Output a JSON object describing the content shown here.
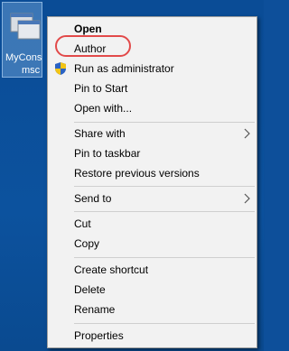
{
  "desktop_icon": {
    "label_line1": "MyCons",
    "label_line2": "msc"
  },
  "context_menu": {
    "items": [
      {
        "label": "Open"
      },
      {
        "label": "Author"
      },
      {
        "label": "Run as administrator",
        "icon": "uac-shield-icon"
      },
      {
        "label": "Pin to Start"
      },
      {
        "label": "Open with..."
      },
      {
        "label": "Share with",
        "submenu": true
      },
      {
        "label": "Pin to taskbar"
      },
      {
        "label": "Restore previous versions"
      },
      {
        "label": "Send to",
        "submenu": true
      },
      {
        "label": "Cut"
      },
      {
        "label": "Copy"
      },
      {
        "label": "Create shortcut"
      },
      {
        "label": "Delete"
      },
      {
        "label": "Rename"
      },
      {
        "label": "Properties"
      }
    ],
    "highlighted_item": "Author",
    "highlight_color": "#e24a4a"
  }
}
